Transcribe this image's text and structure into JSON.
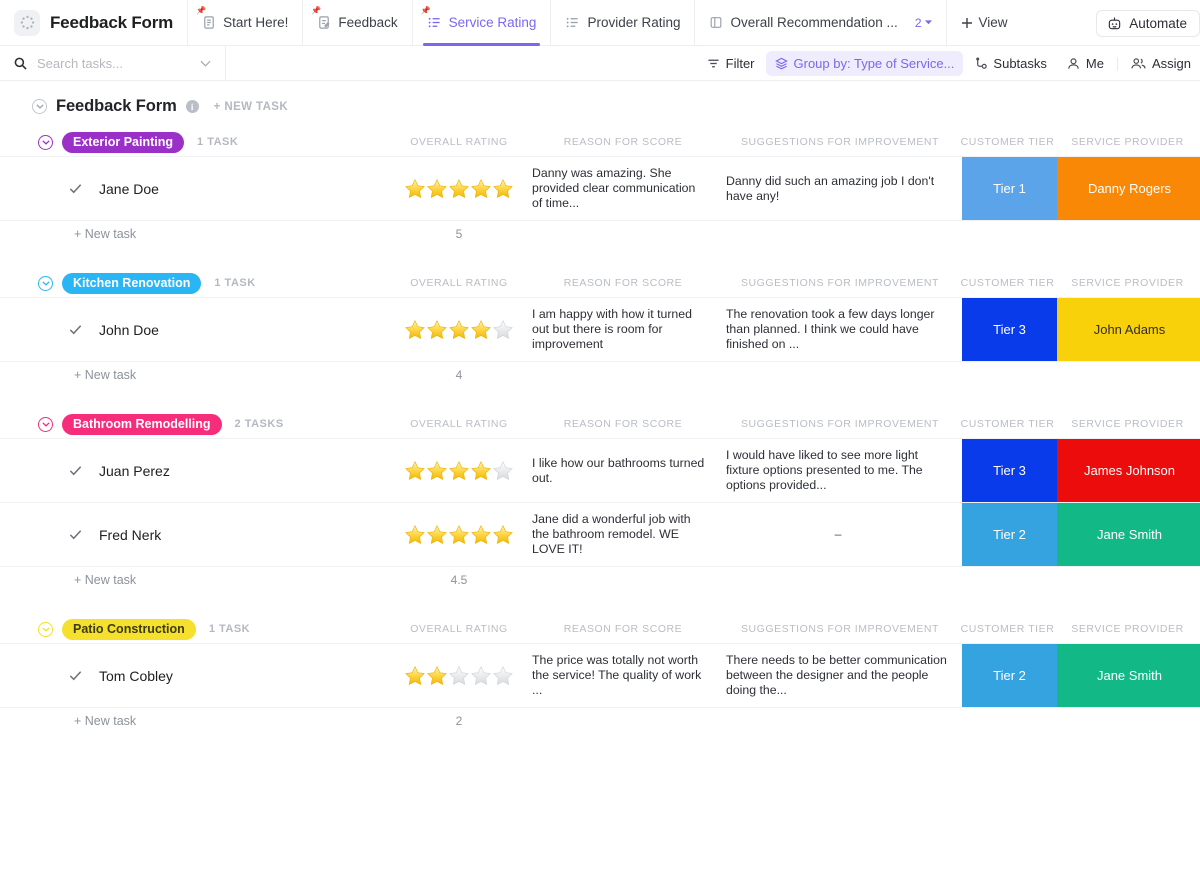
{
  "app": {
    "title": "Feedback Form",
    "logo_icon": "loading-dots-icon"
  },
  "tabs": [
    {
      "label": "Start Here!",
      "icon": "doc-icon",
      "active": false,
      "pinned": true
    },
    {
      "label": "Feedback",
      "icon": "form-doc-icon",
      "active": false,
      "pinned": true
    },
    {
      "label": "Service Rating",
      "icon": "list-view-icon",
      "active": true,
      "pinned": true
    },
    {
      "label": "Provider Rating",
      "icon": "list-view-icon",
      "active": false,
      "pinned": false
    },
    {
      "label": "Overall Recommendation ...",
      "icon": "board-icon",
      "active": false,
      "pinned": false
    }
  ],
  "view_count": "2",
  "add_view_label": "View",
  "automate_label": "Automate",
  "search": {
    "placeholder": "Search tasks...",
    "value": ""
  },
  "toolbar": {
    "filter_label": "Filter",
    "group_by_label": "Group by: Type of Service...",
    "subtasks_label": "Subtasks",
    "me_label": "Me",
    "assign_label": "Assign"
  },
  "list": {
    "title": "Feedback Form",
    "new_task_label": "+ NEW TASK",
    "info_char": "i"
  },
  "columns": {
    "overall_rating": "OVERALL RATING",
    "reason_for_score": "REASON FOR SCORE",
    "suggestions": "SUGGESTIONS FOR IMPROVEMENT",
    "customer_tier": "CUSTOMER TIER",
    "service_provider": "SERVICE PROVIDER"
  },
  "new_task_label": "+ New task",
  "colors": {
    "accent": "#7b68ee",
    "exterior_painting": "#9b30c9",
    "kitchen_renovation": "#2ab5f5",
    "bathroom_remodelling": "#f52d7b",
    "patio_construction": "#f5e02d",
    "tier1": "#5ba4ea",
    "tier2": "#35a3e0",
    "tier3": "#0a3bea",
    "danny_rogers": "#f98806",
    "john_adams": "#f9d10b",
    "james_johnson": "#ed0c0c",
    "jane_smith": "#12b886"
  },
  "groups": [
    {
      "name": "Exterior Painting",
      "pill_color": "#9b30c9",
      "pill_text_color": "#ffffff",
      "count_label": "1 TASK",
      "average": "5",
      "tasks": [
        {
          "name": "Jane Doe",
          "rating": 5,
          "reason": "Danny was amazing. She provided clear communication of time...",
          "suggestion": "Danny did such an amazing job I don't have any!",
          "tier": "Tier 1",
          "tier_color": "#5ba4ea",
          "provider": "Danny Rogers",
          "provider_color": "#f98806"
        }
      ]
    },
    {
      "name": "Kitchen Renovation",
      "pill_color": "#2ab5f5",
      "pill_text_color": "#ffffff",
      "count_label": "1 TASK",
      "average": "4",
      "tasks": [
        {
          "name": "John Doe",
          "rating": 4,
          "reason": "I am happy with how it turned out but there is room for improvement",
          "suggestion": "The renovation took a few days longer than planned. I think we could have finished on ...",
          "tier": "Tier 3",
          "tier_color": "#0a3bea",
          "provider": "John Adams",
          "provider_color": "#f9d10b",
          "provider_text_color": "#2c2f36"
        }
      ]
    },
    {
      "name": "Bathroom Remodelling",
      "pill_color": "#f52d7b",
      "pill_text_color": "#ffffff",
      "count_label": "2 TASKS",
      "average": "4.5",
      "tasks": [
        {
          "name": "Juan Perez",
          "rating": 4,
          "reason": "I like how our bathrooms turned out.",
          "suggestion": "I would have liked to see more light fixture options presented to me. The options provided...",
          "tier": "Tier 3",
          "tier_color": "#0a3bea",
          "provider": "James Johnson",
          "provider_color": "#ed0c0c"
        },
        {
          "name": "Fred Nerk",
          "rating": 5,
          "reason": "Jane did a wonderful job with the bathroom remodel. WE LOVE IT!",
          "suggestion": "–",
          "suggestion_is_dash": true,
          "tier": "Tier 2",
          "tier_color": "#35a3e0",
          "provider": "Jane Smith",
          "provider_color": "#12b886"
        }
      ]
    },
    {
      "name": "Patio Construction",
      "pill_color": "#f5e02d",
      "pill_text_color": "#3d3a12",
      "count_label": "1 TASK",
      "average": "2",
      "tasks": [
        {
          "name": "Tom Cobley",
          "rating": 2,
          "reason": "The price was totally not worth the service! The quality of work ...",
          "suggestion": "There needs to be better communication between the designer and the people doing the...",
          "tier": "Tier 2",
          "tier_color": "#35a3e0",
          "provider": "Jane Smith",
          "provider_color": "#12b886"
        }
      ]
    }
  ]
}
